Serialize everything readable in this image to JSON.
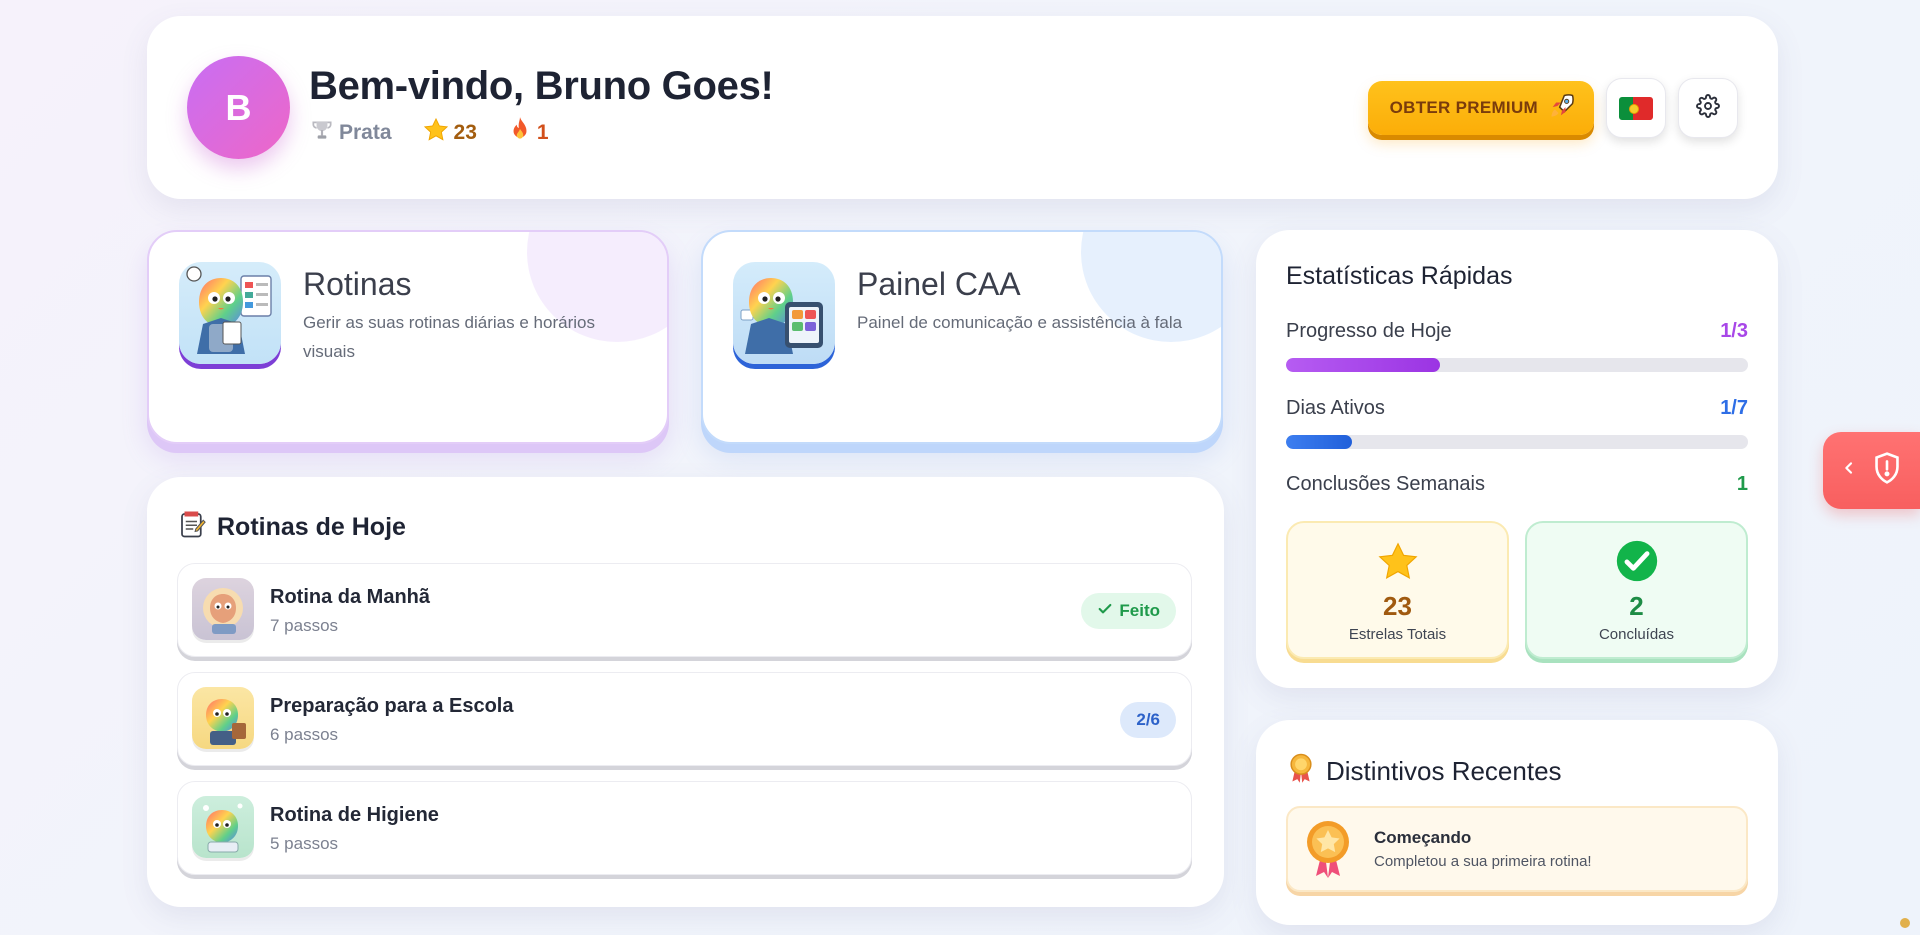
{
  "header": {
    "avatar_letter": "B",
    "welcome": "Bem-vindo, Bruno Goes!",
    "rank": "Prata",
    "stars": "23",
    "streak": "1",
    "premium_label": "OBTER PREMIUM",
    "language_flag": "Portugal flag",
    "settings_icon": "gear-icon"
  },
  "features": [
    {
      "title": "Rotinas",
      "description": "Gerir as suas rotinas diárias e horários visuais"
    },
    {
      "title": "Painel CAA",
      "description": "Painel de comunicação e assistência à fala"
    }
  ],
  "today": {
    "title": "Rotinas de Hoje",
    "routines": [
      {
        "name": "Rotina da Manhã",
        "steps": "7 passos",
        "status": "Feito"
      },
      {
        "name": "Preparação para a Escola",
        "steps": "6 passos",
        "status": "2/6"
      },
      {
        "name": "Rotina de Higiene",
        "steps": "5 passos",
        "status": ""
      }
    ]
  },
  "stats": {
    "title": "Estatísticas Rápidas",
    "today_progress": {
      "label": "Progresso de Hoje",
      "value": "1/3",
      "fraction": 0.333,
      "color": "#a847e8"
    },
    "active_days": {
      "label": "Dias Ativos",
      "value": "1/7",
      "fraction": 0.143,
      "color": "#2e6ee6"
    },
    "weekly": {
      "label": "Conclusões Semanais",
      "value": "1",
      "color": "#1f9a4b"
    },
    "total_stars": {
      "value": "23",
      "label": "Estrelas Totais"
    },
    "completed": {
      "value": "2",
      "label": "Concluídas"
    }
  },
  "badges": {
    "title": "Distintivos Recentes",
    "items": [
      {
        "name": "Começando",
        "description": "Completou a sua primeira rotina!"
      }
    ]
  },
  "colors": {
    "premium": "#fbad08",
    "purple_accent": "#a847e8",
    "blue_accent": "#2e6ee6",
    "green_accent": "#1f9a4b",
    "side_tab": "#f85f5f"
  }
}
